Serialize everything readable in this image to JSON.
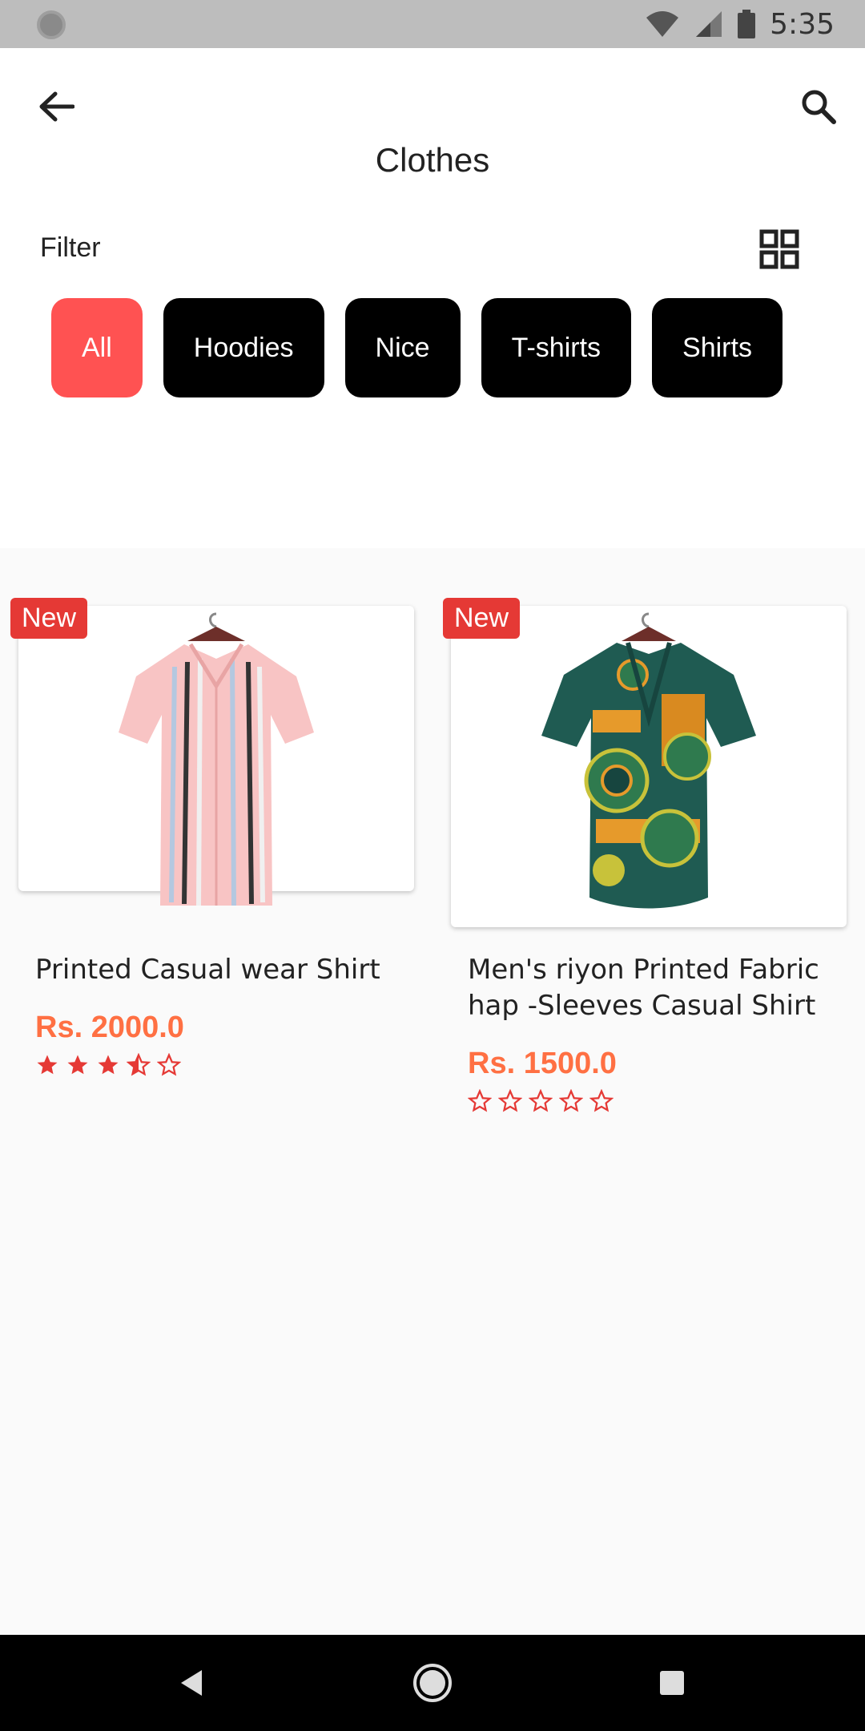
{
  "status_bar": {
    "time": "5:35"
  },
  "header": {
    "title": "Clothes",
    "filter_label": "Filter",
    "icons": [
      "back-arrow-icon",
      "search-icon",
      "grid-view-icon"
    ]
  },
  "categories": [
    {
      "label": "All",
      "active": true
    },
    {
      "label": "Hoodies",
      "active": false
    },
    {
      "label": "Nice",
      "active": false
    },
    {
      "label": "T-shirts",
      "active": false
    },
    {
      "label": "Shirts",
      "active": false
    }
  ],
  "products": [
    {
      "badge": "New",
      "name": "Printed Casual wear Shirt",
      "price": "Rs. 2000.0",
      "rating": 3.5,
      "rating_max": 5
    },
    {
      "badge": "New",
      "name": "Men's riyon Printed Fabric hap -Sleeves Casual Shirt",
      "price": "Rs. 1500.0",
      "rating": 0,
      "rating_max": 5
    }
  ],
  "colors": {
    "accent": "#ff5252",
    "chip": "#000000",
    "price": "#ff7043",
    "badge": "#e53935",
    "star": "#e53935"
  }
}
